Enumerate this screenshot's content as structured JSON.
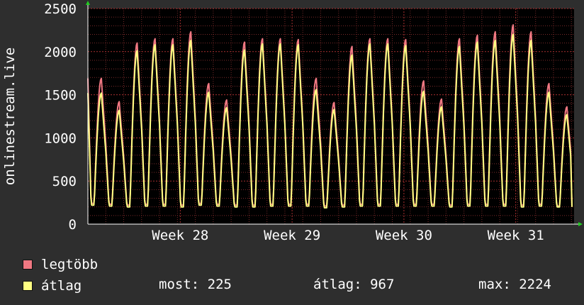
{
  "chart_data": {
    "type": "line",
    "ylabel": "onlinestream.live",
    "ylim": [
      0,
      2500
    ],
    "y_ticks": [
      "0",
      "500",
      "1000",
      "1500",
      "2000",
      "2500"
    ],
    "x_tick_labels": [
      "Week 28",
      "Week 29",
      "Week 30",
      "Week 31"
    ],
    "grid": true,
    "legend_position": "bottom-left",
    "colors": {
      "legtobb": "#f07882",
      "atlag": "#ffff82",
      "grid": "#7a2a2a",
      "background": "#000000",
      "page": "#2e2e2e"
    },
    "series": [
      {
        "name": "legtöbb",
        "daily_peaks": [
          1690,
          1420,
          2100,
          2150,
          2150,
          2230,
          1630,
          1440,
          2110,
          2150,
          2150,
          2140,
          1690,
          1410,
          2060,
          2150,
          2150,
          2140,
          1660,
          1450,
          2150,
          2190,
          2230,
          2310,
          2230,
          1630,
          1360
        ],
        "daily_troughs": [
          240,
          230,
          220,
          230,
          230,
          220,
          240,
          230,
          220,
          220,
          230,
          230,
          230,
          210,
          220,
          230,
          230,
          230,
          230,
          230,
          220,
          230,
          230,
          230,
          220,
          230,
          210
        ]
      },
      {
        "name": "átlag",
        "daily_peaks": [
          1520,
          1320,
          2010,
          2080,
          2080,
          2130,
          1530,
          1350,
          2020,
          2090,
          2090,
          2080,
          1560,
          1330,
          1960,
          2090,
          2090,
          2070,
          1540,
          1360,
          2060,
          2110,
          2130,
          2200,
          2130,
          1530,
          1270
        ],
        "daily_troughs": [
          220,
          210,
          200,
          210,
          210,
          200,
          220,
          210,
          200,
          200,
          210,
          210,
          210,
          190,
          200,
          210,
          210,
          210,
          210,
          210,
          200,
          210,
          210,
          210,
          200,
          210,
          200
        ]
      }
    ]
  },
  "legend": {
    "items": [
      {
        "label": "legtöbb",
        "color": "#f07882"
      },
      {
        "label": "átlag",
        "color": "#ffff82"
      }
    ]
  },
  "stats": {
    "most": "most: 225",
    "atlag": "átlag: 967",
    "max": "max: 2224"
  }
}
